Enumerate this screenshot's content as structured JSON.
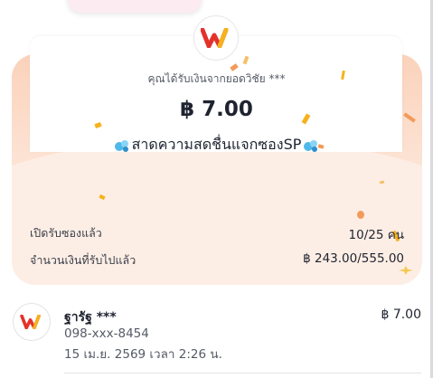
{
  "colors": {
    "accent_red": "#e4322b",
    "accent_yellow": "#f6b11c",
    "envelope_peach": "#fdeee5",
    "confetti_orange": "#f39a5a"
  },
  "icons": {
    "logo": "wallet-w-logo-icon",
    "bubble": "sparkle-bubble-icon"
  },
  "envelope": {
    "message": "คุณได้รับเงินจากยอดวิชัย ***",
    "amount": "฿ 7.00",
    "campaign_title": "สาดความสดชื่นแจกซองSP"
  },
  "stats": {
    "opened_label": "เปิดรับซองแล้ว",
    "opened_value": "10/25 คน",
    "received_label": "จำนวนเงินที่รับไปแล้ว",
    "received_value": "฿ 243.00/555.00"
  },
  "recipient": {
    "name": "ฐารัฐ ***",
    "phone": "098-xxx-8454",
    "time": "15 เม.ย. 2569 เวลา 2:26 น.",
    "amount": "฿ 7.00"
  }
}
